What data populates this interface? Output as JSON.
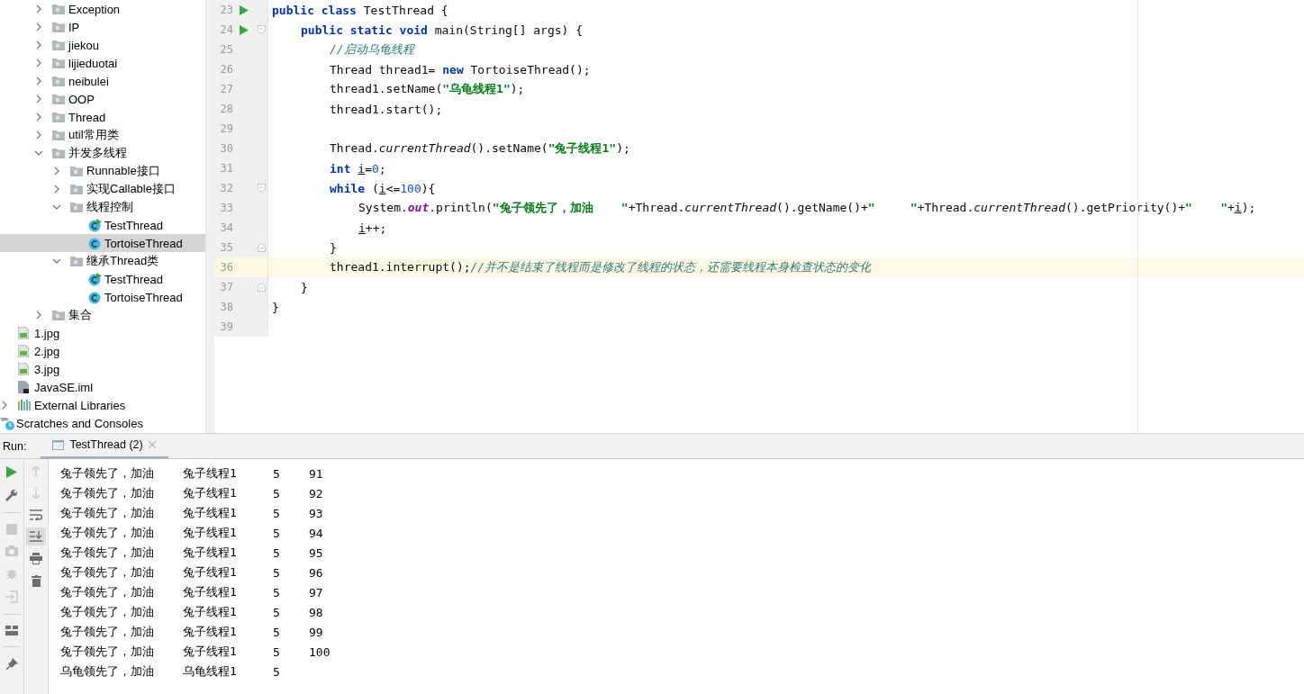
{
  "project_tree": [
    {
      "kind": "folder",
      "label": "Exception",
      "expanded": false,
      "selected": false
    },
    {
      "kind": "folder",
      "label": "IP",
      "expanded": false,
      "selected": false
    },
    {
      "kind": "folder",
      "label": "jiekou",
      "expanded": false,
      "selected": false
    },
    {
      "kind": "folder",
      "label": "lijieduotai",
      "expanded": false,
      "selected": false
    },
    {
      "kind": "folder",
      "label": "neibulei",
      "expanded": false,
      "selected": false
    },
    {
      "kind": "folder",
      "label": "OOP",
      "expanded": false,
      "selected": false
    },
    {
      "kind": "folder",
      "label": "Thread",
      "expanded": false,
      "selected": false
    },
    {
      "kind": "folder",
      "label": "util常用类",
      "expanded": false,
      "selected": false
    },
    {
      "kind": "folder",
      "label": "并发多线程",
      "expanded": true,
      "selected": false,
      "children": [
        {
          "kind": "folder",
          "label": "Runnable接口",
          "expanded": false,
          "selected": false
        },
        {
          "kind": "folder",
          "label": "实现Callable接口",
          "expanded": false,
          "selected": false
        },
        {
          "kind": "folder",
          "label": "线程控制",
          "expanded": true,
          "selected": false,
          "children": [
            {
              "kind": "class_runnable",
              "label": "TestThread",
              "selected": false
            },
            {
              "kind": "class",
              "label": "TortoiseThread",
              "selected": true
            }
          ]
        },
        {
          "kind": "folder",
          "label": "继承Thread类",
          "expanded": true,
          "selected": false,
          "children": [
            {
              "kind": "class_runnable",
              "label": "TestThread",
              "selected": false
            },
            {
              "kind": "class",
              "label": "TortoiseThread",
              "selected": false
            }
          ]
        }
      ]
    },
    {
      "kind": "folder",
      "label": "集合",
      "expanded": false,
      "selected": false
    },
    {
      "kind": "image",
      "label": "1.jpg",
      "selected": false
    },
    {
      "kind": "image",
      "label": "2.jpg",
      "selected": false
    },
    {
      "kind": "image",
      "label": "3.jpg",
      "selected": false
    },
    {
      "kind": "module_file",
      "label": "JavaSE.iml",
      "selected": false
    },
    {
      "kind": "libraries",
      "label": "External Libraries",
      "expanded": false,
      "selected": false
    },
    {
      "kind": "scratches",
      "label": "Scratches and Consoles",
      "selected": false
    }
  ],
  "editor": {
    "lines": [
      {
        "number": "23",
        "run": true,
        "current": false,
        "tokens": [
          {
            "kind": "kw",
            "text": "public class"
          },
          {
            "kind": "plain",
            "text": " TestThread {"
          }
        ],
        "children": [
          {
            "number": "24",
            "run": true,
            "fold_start": true,
            "current": false,
            "tokens": [
              {
                "kind": "kw",
                "text": "public static void"
              },
              {
                "kind": "plain",
                "text": " main(String[] args) {"
              }
            ],
            "children": [
              {
                "number": "25",
                "current": false,
                "tokens": [
                  {
                    "kind": "comment",
                    "text": "//启动乌龟线程"
                  }
                ]
              },
              {
                "number": "26",
                "current": false,
                "tokens": [
                  {
                    "kind": "plain",
                    "text": "Thread thread1= "
                  },
                  {
                    "kind": "kw",
                    "text": "new"
                  },
                  {
                    "kind": "plain",
                    "text": " TortoiseThread();"
                  }
                ]
              },
              {
                "number": "27",
                "current": false,
                "tokens": [
                  {
                    "kind": "plain",
                    "text": "thread1.setName("
                  },
                  {
                    "kind": "string",
                    "text": "\"乌龟线程1\""
                  },
                  {
                    "kind": "plain",
                    "text": ");"
                  }
                ]
              },
              {
                "number": "28",
                "current": false,
                "tokens": [
                  {
                    "kind": "plain",
                    "text": "thread1.start();"
                  }
                ]
              },
              {
                "number": "29",
                "current": false
              },
              {
                "number": "30",
                "current": false,
                "tokens": [
                  {
                    "kind": "plain",
                    "text": "Thread."
                  },
                  {
                    "kind": "static",
                    "text": "currentThread"
                  },
                  {
                    "kind": "plain",
                    "text": "().setName("
                  },
                  {
                    "kind": "string",
                    "text": "\"兔子线程1\""
                  },
                  {
                    "kind": "plain",
                    "text": ");"
                  }
                ]
              },
              {
                "number": "31",
                "current": false,
                "tokens": [
                  {
                    "kind": "kw",
                    "text": "int "
                  },
                  {
                    "kind": "var",
                    "text": "i"
                  },
                  {
                    "kind": "plain",
                    "text": "="
                  },
                  {
                    "kind": "number",
                    "text": "0"
                  },
                  {
                    "kind": "plain",
                    "text": ";"
                  }
                ]
              },
              {
                "number": "32",
                "fold_start": true,
                "current": false,
                "tokens": [
                  {
                    "kind": "kw",
                    "text": "while"
                  },
                  {
                    "kind": "plain",
                    "text": " ("
                  },
                  {
                    "kind": "var",
                    "text": "i"
                  },
                  {
                    "kind": "plain",
                    "text": "<="
                  },
                  {
                    "kind": "number",
                    "text": "100"
                  },
                  {
                    "kind": "plain",
                    "text": "){"
                  }
                ],
                "children": [
                  {
                    "number": "33",
                    "current": false,
                    "tokens": [
                      {
                        "kind": "plain",
                        "text": "System."
                      },
                      {
                        "kind": "field",
                        "text": "out"
                      },
                      {
                        "kind": "plain",
                        "text": ".println("
                      },
                      {
                        "kind": "string",
                        "text": "\"兔子领先了，加油    \""
                      },
                      {
                        "kind": "plain",
                        "text": "+Thread."
                      },
                      {
                        "kind": "static",
                        "text": "currentThread"
                      },
                      {
                        "kind": "plain",
                        "text": "().getName()+"
                      },
                      {
                        "kind": "string",
                        "text": "\"     \""
                      },
                      {
                        "kind": "plain",
                        "text": "+Thread."
                      },
                      {
                        "kind": "static",
                        "text": "currentThread"
                      },
                      {
                        "kind": "plain",
                        "text": "().getPriority()+"
                      },
                      {
                        "kind": "string",
                        "text": "\"    \""
                      },
                      {
                        "kind": "plain",
                        "text": "+"
                      },
                      {
                        "kind": "var",
                        "text": "i"
                      },
                      {
                        "kind": "plain",
                        "text": ");"
                      }
                    ]
                  },
                  {
                    "number": "34",
                    "current": false,
                    "tokens": [
                      {
                        "kind": "var",
                        "text": "i"
                      },
                      {
                        "kind": "plain",
                        "text": "++;"
                      }
                    ]
                  }
                ]
              },
              {
                "number": "35",
                "fold_end": true,
                "current": false,
                "tokens": [
                  {
                    "kind": "plain",
                    "text": "}"
                  }
                ]
              },
              {
                "number": "36",
                "current": true,
                "tokens": [
                  {
                    "kind": "plain",
                    "text": "thread1.interrupt();"
                  },
                  {
                    "kind": "comment",
                    "text": "//并不是结束了线程而是修改了线程的状态，还需要线程本身检查状态的变化"
                  }
                ]
              }
            ]
          },
          {
            "number": "37",
            "fold_end": true,
            "current": false,
            "tokens": [
              {
                "kind": "plain",
                "text": "}"
              }
            ]
          }
        ]
      },
      {
        "number": "38",
        "current": false,
        "tokens": [
          {
            "kind": "plain",
            "text": "}"
          }
        ]
      },
      {
        "number": "39",
        "current": false
      }
    ]
  },
  "run_panel": {
    "label": "Run:",
    "tabs": [
      {
        "label": "TestThread (2)",
        "selected": true
      }
    ],
    "scroll_to_end": true,
    "output": [
      {
        "message": "兔子领先了，加油",
        "thread": "兔子线程1",
        "priority": "5",
        "count": "91"
      },
      {
        "message": "兔子领先了，加油",
        "thread": "兔子线程1",
        "priority": "5",
        "count": "92"
      },
      {
        "message": "兔子领先了，加油",
        "thread": "兔子线程1",
        "priority": "5",
        "count": "93"
      },
      {
        "message": "兔子领先了，加油",
        "thread": "兔子线程1",
        "priority": "5",
        "count": "94"
      },
      {
        "message": "兔子领先了，加油",
        "thread": "兔子线程1",
        "priority": "5",
        "count": "95"
      },
      {
        "message": "兔子领先了，加油",
        "thread": "兔子线程1",
        "priority": "5",
        "count": "96"
      },
      {
        "message": "兔子领先了，加油",
        "thread": "兔子线程1",
        "priority": "5",
        "count": "97"
      },
      {
        "message": "兔子领先了，加油",
        "thread": "兔子线程1",
        "priority": "5",
        "count": "98"
      },
      {
        "message": "兔子领先了，加油",
        "thread": "兔子线程1",
        "priority": "5",
        "count": "99"
      },
      {
        "message": "兔子领先了，加油",
        "thread": "兔子线程1",
        "priority": "5",
        "count": "100"
      },
      {
        "message": "乌龟领先了，加油",
        "thread": "乌龟线程1",
        "priority": "5"
      }
    ]
  }
}
